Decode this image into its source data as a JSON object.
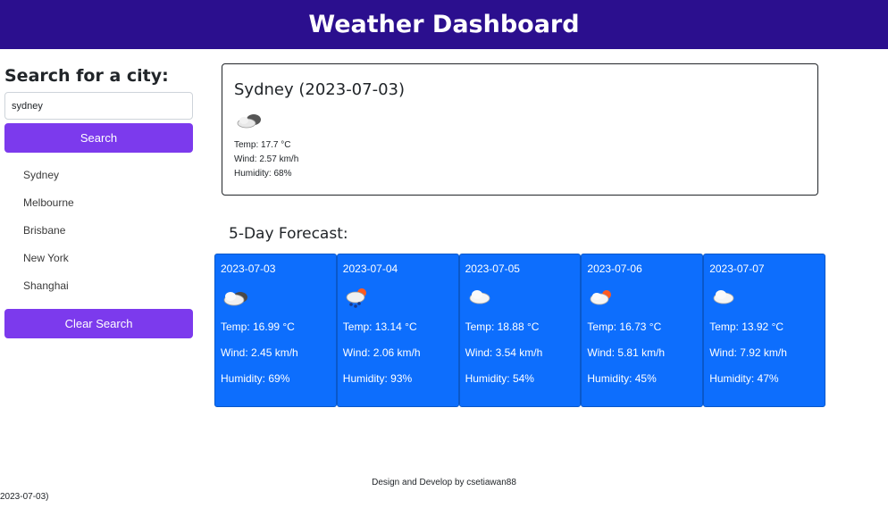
{
  "header": {
    "title": "Weather Dashboard"
  },
  "sidebar": {
    "heading": "Search for a city:",
    "search_value": "sydney",
    "search_button": "Search",
    "history": [
      "Sydney",
      "Melbourne",
      "Brisbane",
      "New York",
      "Shanghai"
    ],
    "clear_button": "Clear Search"
  },
  "current": {
    "title": "Sydney (2023-07-03)",
    "icon": "partly-cloudy-icon",
    "temp": "Temp: 17.7 °C",
    "wind": "Wind: 2.57 km/h",
    "humidity": "Humidity: 68%"
  },
  "forecast": {
    "title": "5-Day Forecast:",
    "days": [
      {
        "date": "2023-07-03",
        "icon": "dark-cloud-icon",
        "temp": "Temp: 16.99 °C",
        "wind": "Wind: 2.45 km/h",
        "humidity": "Humidity: 69%"
      },
      {
        "date": "2023-07-04",
        "icon": "sun-rain-icon",
        "temp": "Temp: 13.14 °C",
        "wind": "Wind: 2.06 km/h",
        "humidity": "Humidity: 93%"
      },
      {
        "date": "2023-07-05",
        "icon": "cloud-icon",
        "temp": "Temp: 18.88 °C",
        "wind": "Wind: 3.54 km/h",
        "humidity": "Humidity: 54%"
      },
      {
        "date": "2023-07-06",
        "icon": "sun-cloud-icon",
        "temp": "Temp: 16.73 °C",
        "wind": "Wind: 5.81 km/h",
        "humidity": "Humidity: 45%"
      },
      {
        "date": "2023-07-07",
        "icon": "cloud-icon",
        "temp": "Temp: 13.92 °C",
        "wind": "Wind: 7.92 km/h",
        "humidity": "Humidity: 47%"
      }
    ]
  },
  "footer": {
    "text": "Design and Develop by csetiawan88"
  },
  "stray_text": "2023-07-03)",
  "colors": {
    "header_bg": "#2b0f8e",
    "button": "#7c3aed",
    "card": "#0d6efd"
  }
}
